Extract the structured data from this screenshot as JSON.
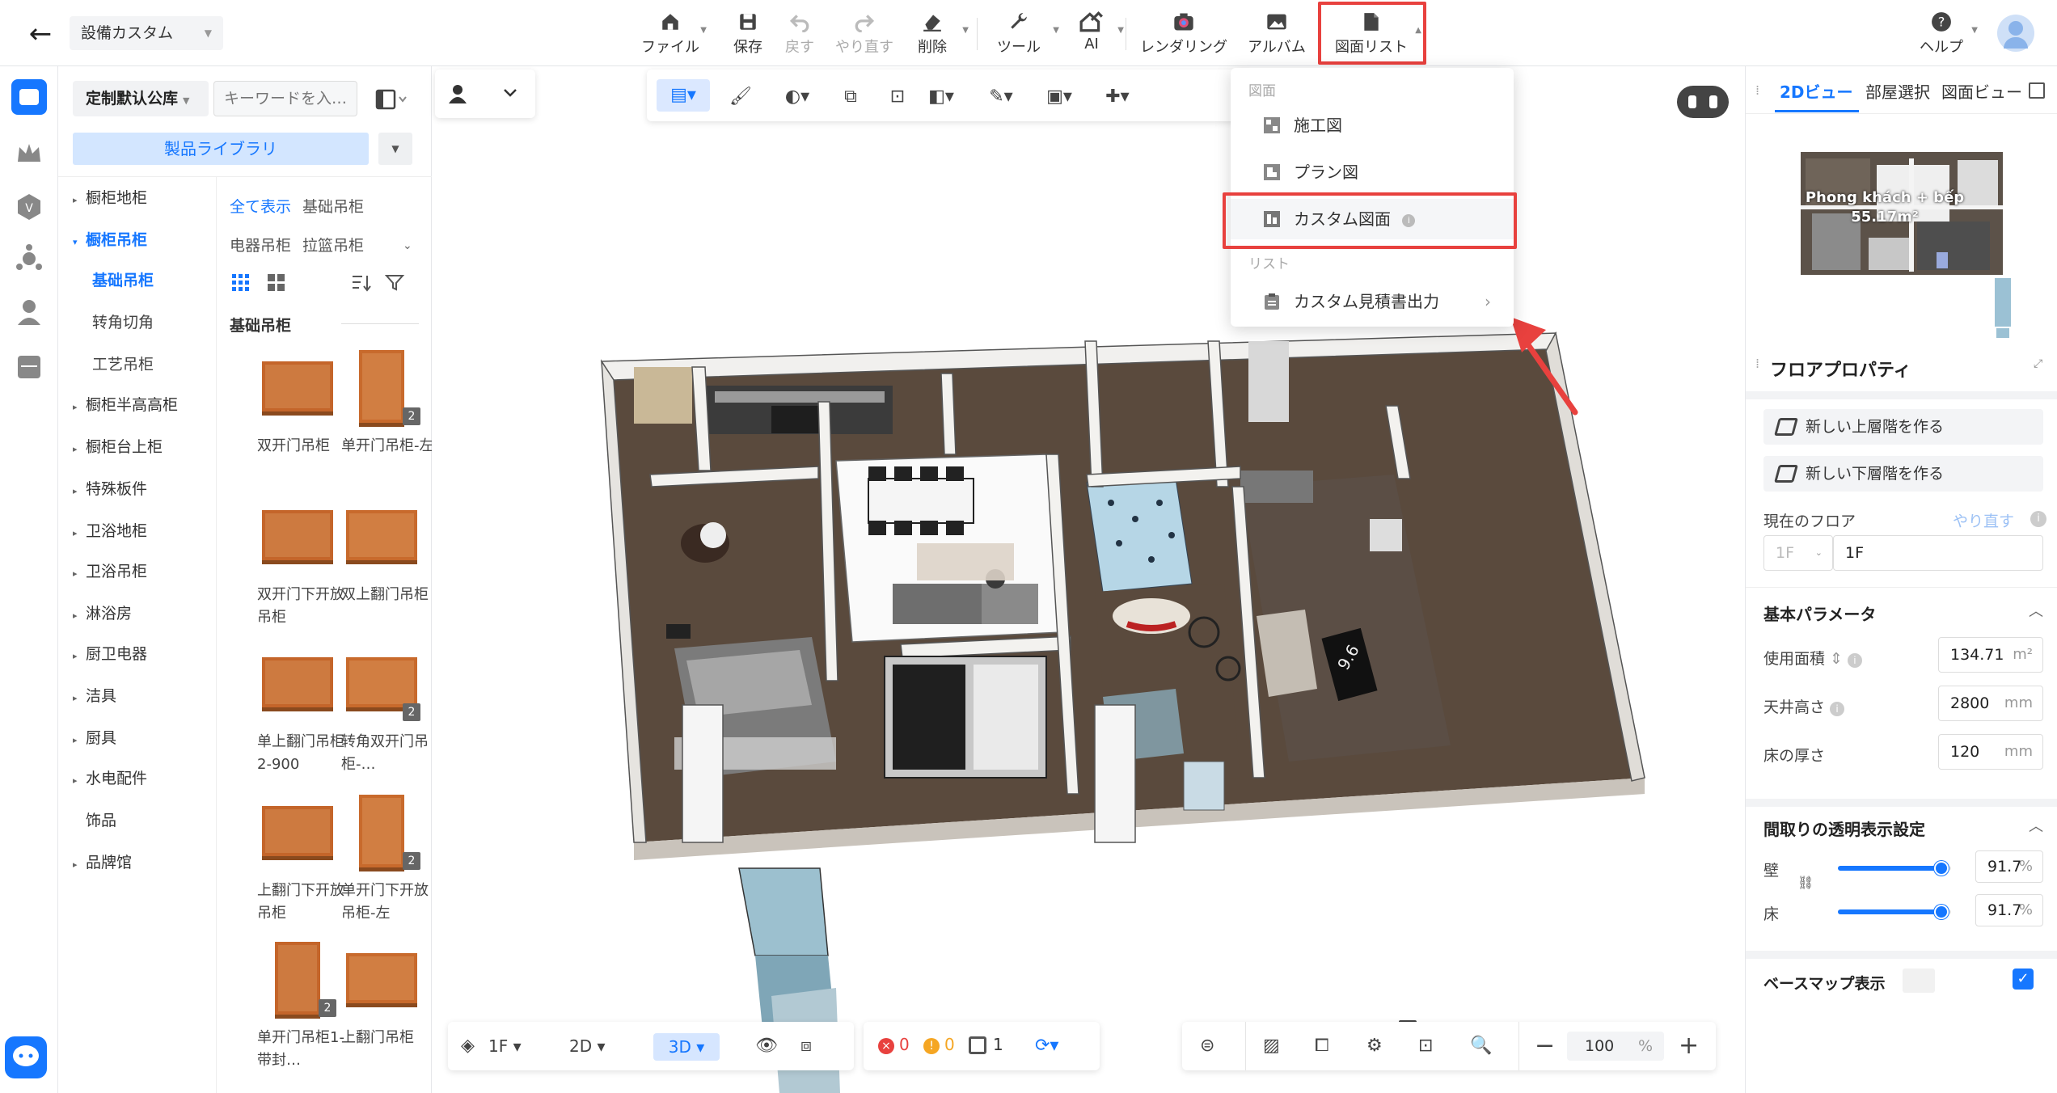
{
  "header": {
    "project_name": "設備カスタム",
    "toolbar": [
      {
        "id": "file",
        "label": "ファイル",
        "icon": "home-icon",
        "has_dropdown": true,
        "disabled": false
      },
      {
        "id": "save",
        "label": "保存",
        "icon": "save-icon",
        "has_dropdown": false,
        "disabled": false
      },
      {
        "id": "undo",
        "label": "戻す",
        "icon": "undo-icon",
        "has_dropdown": false,
        "disabled": true
      },
      {
        "id": "redo",
        "label": "やり直す",
        "icon": "redo-icon",
        "has_dropdown": false,
        "disabled": true
      },
      {
        "id": "delete",
        "label": "削除",
        "icon": "eraser-icon",
        "has_dropdown": true,
        "disabled": false
      },
      {
        "id": "tools",
        "label": "ツール",
        "icon": "wrench-icon",
        "has_dropdown": true,
        "disabled": false
      },
      {
        "id": "ai",
        "label": "AI",
        "icon": "ai-house-icon",
        "has_dropdown": true,
        "disabled": false
      },
      {
        "id": "render",
        "label": "レンダリング",
        "icon": "camera-icon",
        "has_dropdown": false,
        "disabled": false
      },
      {
        "id": "album",
        "label": "アルバム",
        "icon": "album-icon",
        "has_dropdown": false,
        "disabled": false
      },
      {
        "id": "drawings",
        "label": "図面リスト",
        "icon": "document-icon",
        "has_dropdown": true,
        "disabled": false
      }
    ],
    "help_label": "ヘルプ"
  },
  "library": {
    "selector": "定制默认公库",
    "keyword_placeholder": "キーワードを入…",
    "product_library_btn": "製品ライブラリ",
    "categories": [
      {
        "label": "橱柜地柜",
        "expandable": true,
        "active": false
      },
      {
        "label": "橱柜吊柜",
        "expandable": true,
        "active": true
      },
      {
        "label": "基础吊柜",
        "sub": true,
        "active": true
      },
      {
        "label": "转角切角",
        "sub": true,
        "active": false
      },
      {
        "label": "工艺吊柜",
        "sub": true,
        "active": false
      },
      {
        "label": "橱柜半高高柜",
        "expandable": true,
        "active": false
      },
      {
        "label": "橱柜台上柜",
        "expandable": true,
        "active": false
      },
      {
        "label": "特殊板件",
        "expandable": true,
        "active": false
      },
      {
        "label": "卫浴地柜",
        "expandable": true,
        "active": false
      },
      {
        "label": "卫浴吊柜",
        "expandable": true,
        "active": false
      },
      {
        "label": "淋浴房",
        "expandable": true,
        "active": false
      },
      {
        "label": "厨卫电器",
        "expandable": true,
        "active": false
      },
      {
        "label": "洁具",
        "expandable": true,
        "active": false
      },
      {
        "label": "厨具",
        "expandable": true,
        "active": false
      },
      {
        "label": "水电配件",
        "expandable": true,
        "active": false
      },
      {
        "label": "饰品",
        "expandable": false,
        "active": false
      },
      {
        "label": "品牌馆",
        "expandable": true,
        "active": false
      }
    ],
    "filters_row1": [
      "全て表示",
      "基础吊柜"
    ],
    "filters_row2": [
      "电器吊柜",
      "拉篮吊柜"
    ],
    "group_title": "基础吊柜",
    "products": [
      {
        "name": "双开门吊柜",
        "badge": ""
      },
      {
        "name": "单开门吊柜-左",
        "badge": "2"
      },
      {
        "name": "双开门下开放吊柜",
        "badge": ""
      },
      {
        "name": "双上翻门吊柜",
        "badge": ""
      },
      {
        "name": "单上翻门吊柜2-900",
        "badge": ""
      },
      {
        "name": "转角双开门吊柜-…",
        "badge": "2"
      },
      {
        "name": "上翻门下开放吊柜",
        "badge": ""
      },
      {
        "name": "单开门下开放吊柜-左",
        "badge": "2"
      },
      {
        "name": "单开门吊柜1-带封…",
        "badge": "2"
      },
      {
        "name": "上翻门吊柜",
        "badge": ""
      }
    ]
  },
  "dropdown": {
    "section1": "図面",
    "items1": [
      "施工図",
      "プラン図",
      "カスタム図面"
    ],
    "section2": "リスト",
    "items2": [
      "カスタム見積書出力"
    ]
  },
  "right_panel": {
    "tabs": [
      "2Dビュー",
      "部屋選択",
      "図面ビュー"
    ],
    "minimap_room": "Phong khách + bếp",
    "minimap_area": "55.17m²",
    "floor_props_title": "フロアプロパティ",
    "new_upper": "新しい上層階を作る",
    "new_lower": "新しい下層階を作る",
    "current_floor_label": "現在のフロア",
    "redo_link": "やり直す",
    "floor_select": "1F",
    "floor_name": "1F",
    "basic_params_title": "基本パラメータ",
    "area_label": "使用面積",
    "area_value": "134.71",
    "area_unit": "m²",
    "ceiling_label": "天井高さ",
    "ceiling_value": "2800",
    "ceiling_unit": "mm",
    "floor_thick_label": "床の厚さ",
    "floor_thick_value": "120",
    "floor_thick_unit": "mm",
    "transparency_title": "間取りの透明表示設定",
    "wall_label": "壁",
    "wall_value": "91.7",
    "floor_label": "床",
    "floor_value": "91.7",
    "pct": "%",
    "wall_fraction": 0.917,
    "floor_fraction": 0.917,
    "basemap_label": "ベースマップ表示",
    "basemap_checked": true
  },
  "bottom": {
    "floor": "1F",
    "view2d": "2D",
    "view3d": "3D",
    "errors": "0",
    "warnings": "0",
    "count": "1",
    "zoom": "100",
    "zoom_unit": "%"
  },
  "colors": {
    "accent": "#1677ff",
    "highlight": "#e8413e",
    "cabinet": "#d2691e"
  }
}
